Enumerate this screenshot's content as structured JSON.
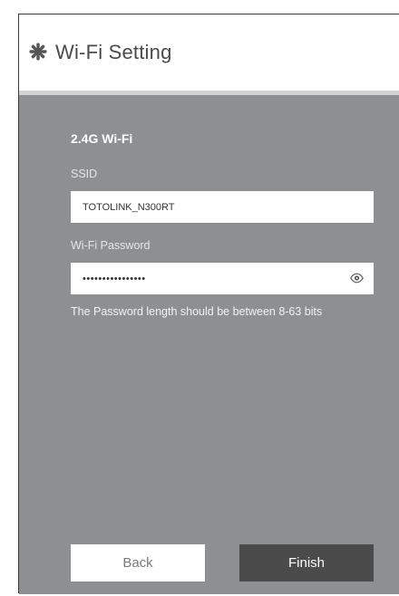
{
  "header": {
    "title": "Wi-Fi Setting",
    "icon": "gear-icon"
  },
  "form": {
    "section_title": "2.4G Wi-Fi",
    "ssid": {
      "label": "SSID",
      "value": "TOTOLINK_N300RT"
    },
    "password": {
      "label": "Wi-Fi Password",
      "masked_value": "••••••••••••••••",
      "visibility_icon": "eye-icon"
    },
    "hint": "The Password length should be between 8-63 bits"
  },
  "buttons": {
    "back_label": "Back",
    "finish_label": "Finish"
  },
  "colors": {
    "panel": "#8e8f91",
    "header_bg": "#ffffff",
    "finish_bg": "#4b4b4b"
  }
}
